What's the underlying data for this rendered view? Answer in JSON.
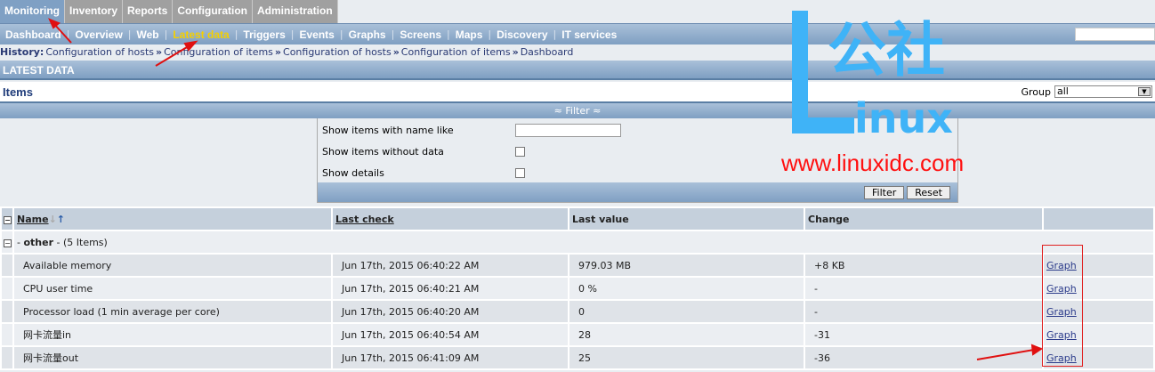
{
  "top_menu": [
    "Monitoring",
    "Inventory",
    "Reports",
    "Configuration",
    "Administration"
  ],
  "sub_menu": [
    "Dashboard",
    "Overview",
    "Web",
    "Latest data",
    "Triggers",
    "Events",
    "Graphs",
    "Screens",
    "Maps",
    "Discovery",
    "IT services"
  ],
  "history": {
    "label": "History:",
    "items": [
      "Configuration of hosts",
      "Configuration of items",
      "Configuration of hosts",
      "Configuration of items",
      "Dashboard"
    ],
    "sep": "»"
  },
  "section_title": "LATEST DATA",
  "items_title": "Items",
  "group": {
    "label": "Group",
    "value": "all"
  },
  "filter": {
    "toggle": "≈ Filter ≈",
    "name_like_label": "Show items with name like",
    "name_like_value": "",
    "without_data_label": "Show items without data",
    "details_label": "Show details",
    "filter_btn": "Filter",
    "reset_btn": "Reset"
  },
  "table": {
    "headers": [
      "Name",
      "Last check",
      "Last value",
      "Change",
      ""
    ],
    "group": {
      "name": "other",
      "count": "(5 Items)"
    },
    "rows": [
      {
        "name": "Available memory",
        "last_check": "Jun 17th, 2015 06:40:22 AM",
        "last_value": "979.03 MB",
        "change": "+8 KB",
        "link": "Graph"
      },
      {
        "name": "CPU user time",
        "last_check": "Jun 17th, 2015 06:40:21 AM",
        "last_value": "0 %",
        "change": "-",
        "link": "Graph"
      },
      {
        "name": "Processor load (1 min average per core)",
        "last_check": "Jun 17th, 2015 06:40:20 AM",
        "last_value": "0",
        "change": "-",
        "link": "Graph"
      },
      {
        "name": "网卡流量in",
        "last_check": "Jun 17th, 2015 06:40:54 AM",
        "last_value": "28",
        "change": "-31",
        "link": "Graph"
      },
      {
        "name": "网卡流量out",
        "last_check": "Jun 17th, 2015 06:41:09 AM",
        "last_value": "25",
        "change": "-36",
        "link": "Graph"
      }
    ]
  },
  "watermark": {
    "big": "公社",
    "sub": "inux",
    "url": "www.linuxidc.com"
  }
}
